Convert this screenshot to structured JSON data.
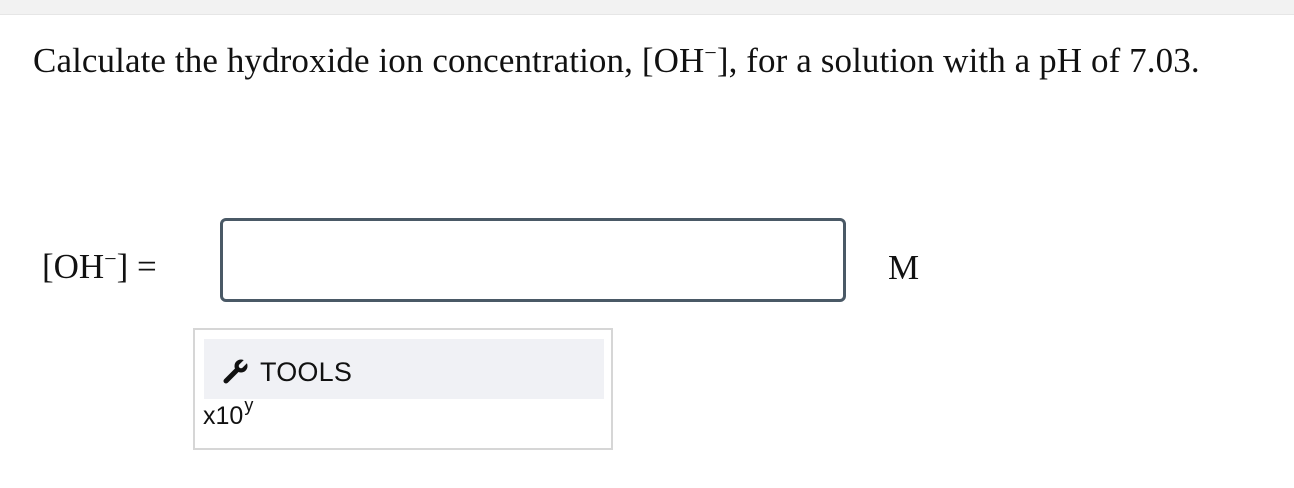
{
  "question": {
    "text_before": "Calculate the hydroxide ion concentration, [OH",
    "superscript": "−",
    "text_after": "], for a solution with a pH of 7.03."
  },
  "answer_row": {
    "label_before": "[OH",
    "label_superscript": "−",
    "label_after": "] =",
    "input_value": "",
    "input_placeholder": "",
    "unit": "M"
  },
  "tools": {
    "icon": "wrench-icon",
    "label": "TOOLS",
    "sci_base": "x10",
    "sci_exponent": "y"
  }
}
